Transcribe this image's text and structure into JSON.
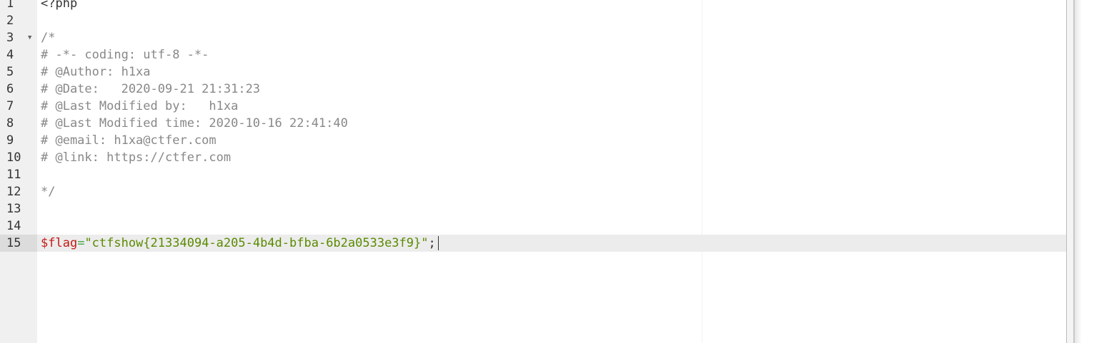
{
  "editor": {
    "active_line": 15,
    "lines": [
      {
        "n": "1",
        "text": "<?php"
      },
      {
        "n": "2",
        "text": ""
      },
      {
        "n": "3",
        "text": "/*"
      },
      {
        "n": "4",
        "text": "# -*- coding: utf-8 -*-"
      },
      {
        "n": "5",
        "text": "# @Author: h1xa"
      },
      {
        "n": "6",
        "text": "# @Date:   2020-09-21 21:31:23"
      },
      {
        "n": "7",
        "text": "# @Last Modified by:   h1xa"
      },
      {
        "n": "8",
        "text": "# @Last Modified time: 2020-10-16 22:41:40"
      },
      {
        "n": "9",
        "text": "# @email: h1xa@ctfer.com"
      },
      {
        "n": "10",
        "text": "# @link: https://ctfer.com"
      },
      {
        "n": "11",
        "text": ""
      },
      {
        "n": "12",
        "text": "*/"
      },
      {
        "n": "13",
        "text": ""
      },
      {
        "n": "14",
        "text": ""
      },
      {
        "n": "15",
        "var": "$flag",
        "op": "=",
        "str": "\"ctfshow{21334094-a205-4b4d-bfba-6b2a0533e3f9}\"",
        "punct": ";"
      }
    ],
    "fold_icon": "fold-triangle-down-icon",
    "colors": {
      "gutter_bg": "#f0f0f0",
      "comment": "#888888",
      "variable": "#c41a16",
      "operator": "#43a547",
      "string": "#5b8a00",
      "active_line_bg": "#ececec"
    }
  }
}
